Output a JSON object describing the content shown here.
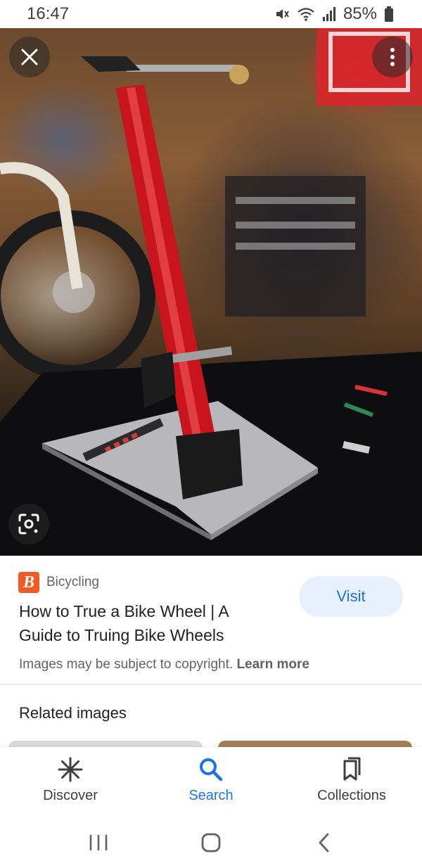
{
  "status_bar": {
    "time": "16:47",
    "battery_percent": "85%",
    "icons": [
      "mute-icon",
      "wifi-icon",
      "signal-icon",
      "battery-icon"
    ]
  },
  "viewer": {
    "close_icon": "close-icon",
    "more_icon": "more-vert-icon",
    "lens_icon": "google-lens-icon"
  },
  "result": {
    "source_logo_letter": "B",
    "source_name": "Bicycling",
    "title": "How to True a Bike Wheel | A Guide to Truing Bike Wheels",
    "visit_label": "Visit",
    "copyright_text": "Images may be subject to copyright.",
    "learn_more": "Learn more"
  },
  "related": {
    "heading": "Related images"
  },
  "bottom_nav": {
    "items": [
      {
        "label": "Discover",
        "icon": "asterisk-icon",
        "active": false
      },
      {
        "label": "Search",
        "icon": "search-icon",
        "active": true
      },
      {
        "label": "Collections",
        "icon": "collections-icon",
        "active": false
      }
    ]
  },
  "system_nav": {
    "icons": [
      "recents-icon",
      "home-icon",
      "back-icon"
    ]
  },
  "colors": {
    "accent": "#1a73e8",
    "visit_bg": "#e8f0fe",
    "source_logo_bg": "#f15a24",
    "truing_stand": "#c8151d"
  }
}
